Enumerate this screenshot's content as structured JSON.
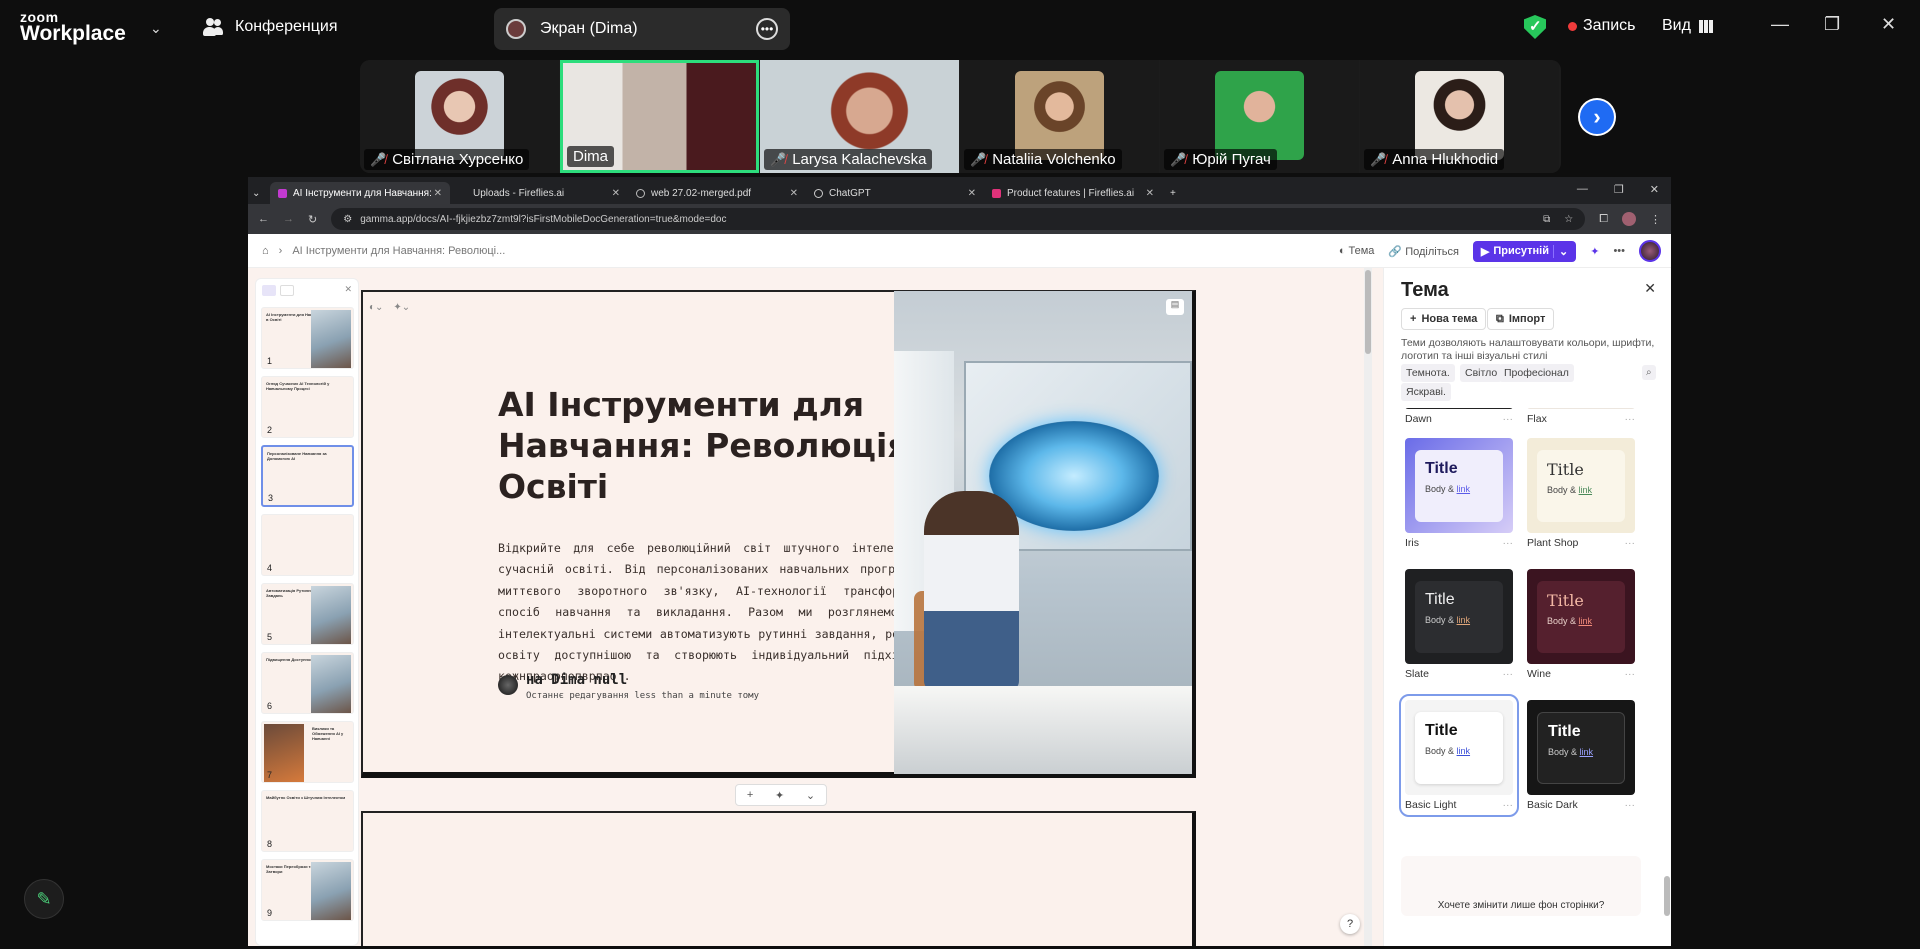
{
  "zoom": {
    "logo_top": "zoom",
    "logo_bottom": "Workplace",
    "meeting_label": "Конференция",
    "screen_share_label": "Экран (Dima)",
    "record_label": "Запись",
    "view_label": "Вид",
    "participants": [
      {
        "name": "Світлана Хурсенко",
        "muted": true
      },
      {
        "name": "Dima",
        "muted": false
      },
      {
        "name": "Larysa Kalachevska",
        "muted": true
      },
      {
        "name": "Nataliia Volchenko",
        "muted": true
      },
      {
        "name": "Юрій Пугач",
        "muted": true
      },
      {
        "name": "Anna Hlukhodid",
        "muted": true
      }
    ]
  },
  "browser": {
    "tabs": [
      {
        "title": "AI Інструменти для Навчання:",
        "active": true
      },
      {
        "title": "Uploads - Fireflies.ai",
        "active": false
      },
      {
        "title": "web 27.02-merged.pdf",
        "active": false
      },
      {
        "title": "ChatGPT",
        "active": false
      },
      {
        "title": "Product features | Fireflies.ai",
        "active": false
      }
    ],
    "url": "gamma.app/docs/AI--fjkjiezbz7zmt9l?isFirstMobileDocGeneration=true&mode=doc"
  },
  "gamma": {
    "breadcrumb": "AI Інструменти для Навчання: Революці...",
    "theme_btn": "Тема",
    "share_btn": "Поділіться",
    "present_btn": "Присутній",
    "slide_numbers": [
      "1",
      "2",
      "3",
      "4",
      "5",
      "6",
      "7",
      "8",
      "9"
    ],
    "card": {
      "title": "AI Інструменти для Навчання: Революція в Освіті",
      "description": "Відкрийте для себе революційний світ штучного інтелекту в сучасній освіті. Від персоналізованих навчальних програм до миттєвого зворотного зв'язку, AI-технології трансформують спосіб навчання та викладання. Разом ми розглянемо, як інтелектуальні системи автоматизують рутинні завдання, роблять освіту доступнішою та створюють індивідуальний підхід до кожнпраорпопврпао .",
      "author": "на Dima null",
      "edited": "Останнє редагування less than a minute тому"
    },
    "help": "?"
  },
  "theme_panel": {
    "title": "Тема",
    "new_theme": "Нова тема",
    "import": "Імпорт",
    "info": "Теми дозволяють налаштовувати кольори, шрифти, логотип та інші візуальні стилі",
    "filters": [
      "Темнота.",
      "Світло",
      "Професіонал",
      "Яскраві."
    ],
    "themes": [
      {
        "name": "Dawn",
        "title": "",
        "body": ""
      },
      {
        "name": "Flax",
        "title": "",
        "body": ""
      },
      {
        "name": "Iris",
        "title": "Title",
        "body": "Body & ",
        "link": "link"
      },
      {
        "name": "Plant Shop",
        "title": "Title",
        "body": "Body & ",
        "link": "link"
      },
      {
        "name": "Slate",
        "title": "Title",
        "body": "Body & ",
        "link": "link"
      },
      {
        "name": "Wine",
        "title": "Title",
        "body": "Body & ",
        "link": "link"
      },
      {
        "name": "Basic Light",
        "title": "Title",
        "body": "Body & ",
        "link": "link"
      },
      {
        "name": "Basic Dark",
        "title": "Title",
        "body": "Body & ",
        "link": "link"
      }
    ],
    "footer_prompt": "Хочете змінити лише фон сторінки?"
  }
}
